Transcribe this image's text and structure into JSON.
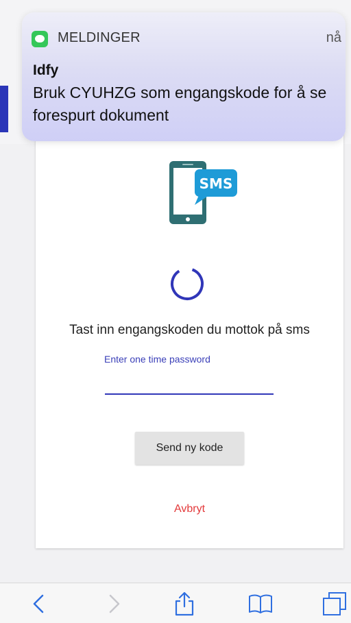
{
  "notification": {
    "app_icon": "messages-icon",
    "app_name": "MELDINGER",
    "time": "nå",
    "sender": "Idfy",
    "body": "Bruk CYUHZG som engangskode for å se forespurt dokument"
  },
  "page": {
    "sms_graphic": {
      "icon": "phone-sms-icon",
      "badge_text": "SMS"
    },
    "spinner": "loading-spinner",
    "instruction": "Tast inn engangskoden du mottok på sms",
    "otp_field": {
      "label": "Enter one time password",
      "value": ""
    },
    "resend_label": "Send ny kode",
    "cancel_label": "Avbryt"
  },
  "toolbar": {
    "items": [
      {
        "icon": "back-icon",
        "enabled": true
      },
      {
        "icon": "forward-icon",
        "enabled": false
      },
      {
        "icon": "share-icon",
        "enabled": true
      },
      {
        "icon": "bookmarks-icon",
        "enabled": true
      },
      {
        "icon": "tabs-icon",
        "enabled": true
      }
    ]
  },
  "colors": {
    "accent_blue": "#3036b8",
    "cancel_red": "#e3393a",
    "sms_blue": "#1e9bd7",
    "phone_teal": "#2f6f73",
    "messages_green": "#34c759"
  }
}
